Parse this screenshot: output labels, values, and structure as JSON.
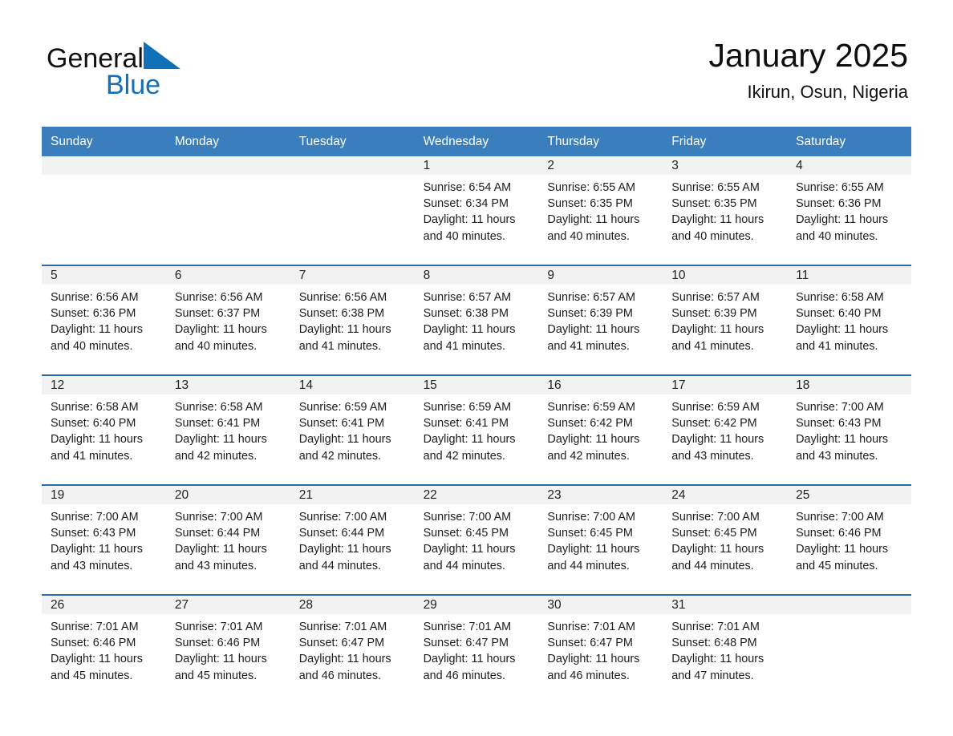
{
  "brand": {
    "name_part1": "General",
    "name_part2": "Blue",
    "triangle_color": "#1070b8"
  },
  "header": {
    "month_title": "January 2025",
    "location": "Ikirun, Osun, Nigeria",
    "header_bg_color": "#3b7ebd",
    "row_border_color": "#2b6ca8",
    "daynum_band_color": "#f2f2f2"
  },
  "weekdays": [
    "Sunday",
    "Monday",
    "Tuesday",
    "Wednesday",
    "Thursday",
    "Friday",
    "Saturday"
  ],
  "weeks": [
    [
      {
        "day": "",
        "sunrise": "",
        "sunset": "",
        "daylight": ""
      },
      {
        "day": "",
        "sunrise": "",
        "sunset": "",
        "daylight": ""
      },
      {
        "day": "",
        "sunrise": "",
        "sunset": "",
        "daylight": ""
      },
      {
        "day": "1",
        "sunrise": "Sunrise: 6:54 AM",
        "sunset": "Sunset: 6:34 PM",
        "daylight": "Daylight: 11 hours and 40 minutes."
      },
      {
        "day": "2",
        "sunrise": "Sunrise: 6:55 AM",
        "sunset": "Sunset: 6:35 PM",
        "daylight": "Daylight: 11 hours and 40 minutes."
      },
      {
        "day": "3",
        "sunrise": "Sunrise: 6:55 AM",
        "sunset": "Sunset: 6:35 PM",
        "daylight": "Daylight: 11 hours and 40 minutes."
      },
      {
        "day": "4",
        "sunrise": "Sunrise: 6:55 AM",
        "sunset": "Sunset: 6:36 PM",
        "daylight": "Daylight: 11 hours and 40 minutes."
      }
    ],
    [
      {
        "day": "5",
        "sunrise": "Sunrise: 6:56 AM",
        "sunset": "Sunset: 6:36 PM",
        "daylight": "Daylight: 11 hours and 40 minutes."
      },
      {
        "day": "6",
        "sunrise": "Sunrise: 6:56 AM",
        "sunset": "Sunset: 6:37 PM",
        "daylight": "Daylight: 11 hours and 40 minutes."
      },
      {
        "day": "7",
        "sunrise": "Sunrise: 6:56 AM",
        "sunset": "Sunset: 6:38 PM",
        "daylight": "Daylight: 11 hours and 41 minutes."
      },
      {
        "day": "8",
        "sunrise": "Sunrise: 6:57 AM",
        "sunset": "Sunset: 6:38 PM",
        "daylight": "Daylight: 11 hours and 41 minutes."
      },
      {
        "day": "9",
        "sunrise": "Sunrise: 6:57 AM",
        "sunset": "Sunset: 6:39 PM",
        "daylight": "Daylight: 11 hours and 41 minutes."
      },
      {
        "day": "10",
        "sunrise": "Sunrise: 6:57 AM",
        "sunset": "Sunset: 6:39 PM",
        "daylight": "Daylight: 11 hours and 41 minutes."
      },
      {
        "day": "11",
        "sunrise": "Sunrise: 6:58 AM",
        "sunset": "Sunset: 6:40 PM",
        "daylight": "Daylight: 11 hours and 41 minutes."
      }
    ],
    [
      {
        "day": "12",
        "sunrise": "Sunrise: 6:58 AM",
        "sunset": "Sunset: 6:40 PM",
        "daylight": "Daylight: 11 hours and 41 minutes."
      },
      {
        "day": "13",
        "sunrise": "Sunrise: 6:58 AM",
        "sunset": "Sunset: 6:41 PM",
        "daylight": "Daylight: 11 hours and 42 minutes."
      },
      {
        "day": "14",
        "sunrise": "Sunrise: 6:59 AM",
        "sunset": "Sunset: 6:41 PM",
        "daylight": "Daylight: 11 hours and 42 minutes."
      },
      {
        "day": "15",
        "sunrise": "Sunrise: 6:59 AM",
        "sunset": "Sunset: 6:41 PM",
        "daylight": "Daylight: 11 hours and 42 minutes."
      },
      {
        "day": "16",
        "sunrise": "Sunrise: 6:59 AM",
        "sunset": "Sunset: 6:42 PM",
        "daylight": "Daylight: 11 hours and 42 minutes."
      },
      {
        "day": "17",
        "sunrise": "Sunrise: 6:59 AM",
        "sunset": "Sunset: 6:42 PM",
        "daylight": "Daylight: 11 hours and 43 minutes."
      },
      {
        "day": "18",
        "sunrise": "Sunrise: 7:00 AM",
        "sunset": "Sunset: 6:43 PM",
        "daylight": "Daylight: 11 hours and 43 minutes."
      }
    ],
    [
      {
        "day": "19",
        "sunrise": "Sunrise: 7:00 AM",
        "sunset": "Sunset: 6:43 PM",
        "daylight": "Daylight: 11 hours and 43 minutes."
      },
      {
        "day": "20",
        "sunrise": "Sunrise: 7:00 AM",
        "sunset": "Sunset: 6:44 PM",
        "daylight": "Daylight: 11 hours and 43 minutes."
      },
      {
        "day": "21",
        "sunrise": "Sunrise: 7:00 AM",
        "sunset": "Sunset: 6:44 PM",
        "daylight": "Daylight: 11 hours and 44 minutes."
      },
      {
        "day": "22",
        "sunrise": "Sunrise: 7:00 AM",
        "sunset": "Sunset: 6:45 PM",
        "daylight": "Daylight: 11 hours and 44 minutes."
      },
      {
        "day": "23",
        "sunrise": "Sunrise: 7:00 AM",
        "sunset": "Sunset: 6:45 PM",
        "daylight": "Daylight: 11 hours and 44 minutes."
      },
      {
        "day": "24",
        "sunrise": "Sunrise: 7:00 AM",
        "sunset": "Sunset: 6:45 PM",
        "daylight": "Daylight: 11 hours and 44 minutes."
      },
      {
        "day": "25",
        "sunrise": "Sunrise: 7:00 AM",
        "sunset": "Sunset: 6:46 PM",
        "daylight": "Daylight: 11 hours and 45 minutes."
      }
    ],
    [
      {
        "day": "26",
        "sunrise": "Sunrise: 7:01 AM",
        "sunset": "Sunset: 6:46 PM",
        "daylight": "Daylight: 11 hours and 45 minutes."
      },
      {
        "day": "27",
        "sunrise": "Sunrise: 7:01 AM",
        "sunset": "Sunset: 6:46 PM",
        "daylight": "Daylight: 11 hours and 45 minutes."
      },
      {
        "day": "28",
        "sunrise": "Sunrise: 7:01 AM",
        "sunset": "Sunset: 6:47 PM",
        "daylight": "Daylight: 11 hours and 46 minutes."
      },
      {
        "day": "29",
        "sunrise": "Sunrise: 7:01 AM",
        "sunset": "Sunset: 6:47 PM",
        "daylight": "Daylight: 11 hours and 46 minutes."
      },
      {
        "day": "30",
        "sunrise": "Sunrise: 7:01 AM",
        "sunset": "Sunset: 6:47 PM",
        "daylight": "Daylight: 11 hours and 46 minutes."
      },
      {
        "day": "31",
        "sunrise": "Sunrise: 7:01 AM",
        "sunset": "Sunset: 6:48 PM",
        "daylight": "Daylight: 11 hours and 47 minutes."
      },
      {
        "day": "",
        "sunrise": "",
        "sunset": "",
        "daylight": ""
      }
    ]
  ]
}
